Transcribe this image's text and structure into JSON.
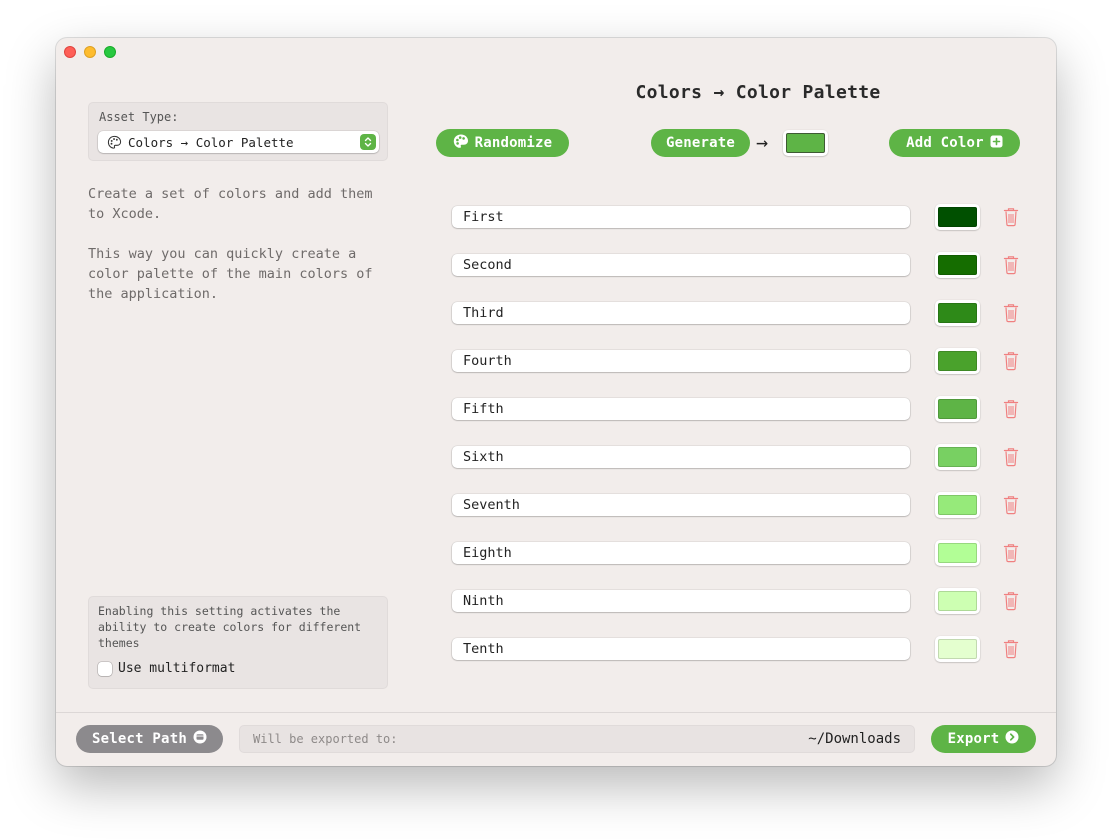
{
  "window": {
    "traffic_lights": [
      "close",
      "minimize",
      "zoom"
    ]
  },
  "sidebar": {
    "asset_type_label": "Asset Type:",
    "asset_type_value": "Colors → Color Palette",
    "asset_type_icon": "palette-icon",
    "description": "Create a set of colors and add them\nto Xcode.\n\nThis way you can quickly create a\ncolor palette of the main colors of\nthe application.",
    "multiformat_help": "Enabling this setting activates the ability to create colors for different themes",
    "multiformat_label": "Use multiformat",
    "multiformat_checked": false
  },
  "header": {
    "title": "Colors → Color Palette",
    "randomize_label": "Randomize",
    "generate_label": "Generate",
    "generate_arrow": "→",
    "generate_base_color": "#5eb446",
    "add_color_label": "Add Color"
  },
  "colors": [
    {
      "name": "First",
      "color": "#005000"
    },
    {
      "name": "Second",
      "color": "#156d00"
    },
    {
      "name": "Third",
      "color": "#2e8a18"
    },
    {
      "name": "Fourth",
      "color": "#4aa22c"
    },
    {
      "name": "Fifth",
      "color": "#5eb446"
    },
    {
      "name": "Sixth",
      "color": "#78d062"
    },
    {
      "name": "Seventh",
      "color": "#96ea7a"
    },
    {
      "name": "Eighth",
      "color": "#b2fe96"
    },
    {
      "name": "Ninth",
      "color": "#cdffb2"
    },
    {
      "name": "Tenth",
      "color": "#e4ffcf"
    }
  ],
  "footer": {
    "select_path_label": "Select Path",
    "export_placeholder": "Will be exported to:",
    "export_path": "~/Downloads",
    "export_label": "Export"
  },
  "theme": {
    "accent": "#5eb446",
    "secondary_button": "#8c8a8d",
    "delete_icon": "#f08080",
    "background": "#f2edeb"
  }
}
